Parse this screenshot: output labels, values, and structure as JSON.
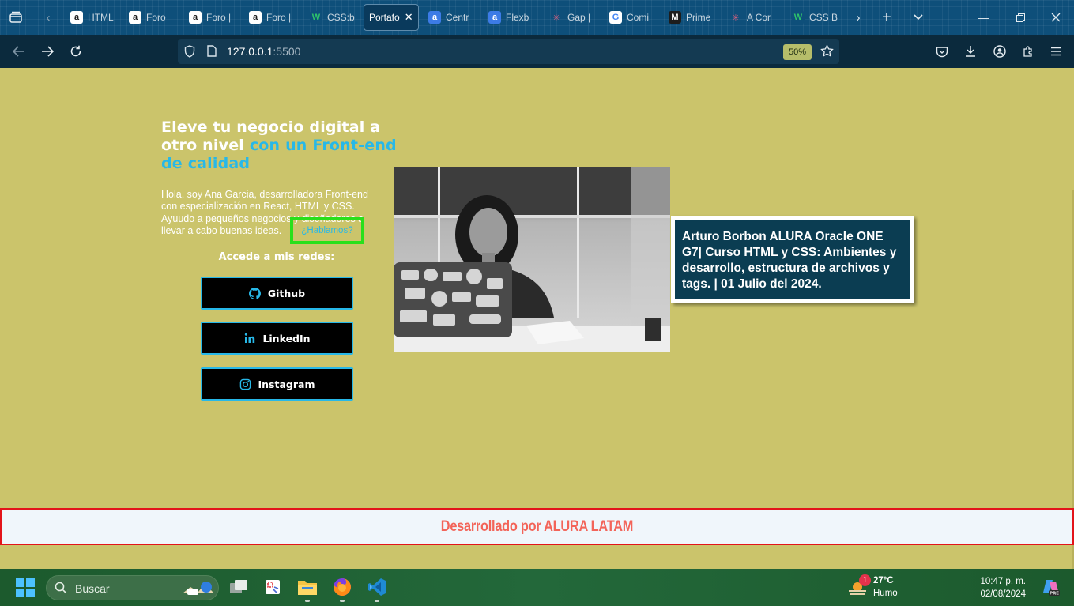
{
  "browser": {
    "tabs": [
      {
        "label": "HTML",
        "favicon": "a",
        "fav_bg": "#ffffff",
        "fav_fg": "#1e1e1e"
      },
      {
        "label": "Foro",
        "favicon": "a",
        "fav_bg": "#ffffff",
        "fav_fg": "#1e1e1e"
      },
      {
        "label": "Foro |",
        "favicon": "a",
        "fav_bg": "#ffffff",
        "fav_fg": "#1e1e1e"
      },
      {
        "label": "Foro |",
        "favicon": "a",
        "fav_bg": "#ffffff",
        "fav_fg": "#1e1e1e"
      },
      {
        "label": "CSS:b",
        "favicon": "W",
        "fav_bg": "#0e4f7a",
        "fav_fg": "#2ec36a"
      },
      {
        "label": "Portafo",
        "favicon": "",
        "fav_bg": "transparent",
        "fav_fg": "#ffffff",
        "active": true
      },
      {
        "label": "Centr",
        "favicon": "a",
        "fav_bg": "#3c7be6",
        "fav_fg": "#ffffff"
      },
      {
        "label": "Flexb",
        "favicon": "a",
        "fav_bg": "#3c7be6",
        "fav_fg": "#ffffff"
      },
      {
        "label": "Gap |",
        "favicon": "✳",
        "fav_bg": "transparent",
        "fav_fg": "#e0607e"
      },
      {
        "label": "Comi",
        "favicon": "G",
        "fav_bg": "#ffffff",
        "fav_fg": "#4285f4"
      },
      {
        "label": "Prime",
        "favicon": "M",
        "fav_bg": "#1d1d1d",
        "fav_fg": "#ffffff"
      },
      {
        "label": "A Cor",
        "favicon": "✳",
        "fav_bg": "transparent",
        "fav_fg": "#e0607e"
      },
      {
        "label": "CSS B",
        "favicon": "W",
        "fav_bg": "#0e4f7a",
        "fav_fg": "#2ec36a"
      }
    ],
    "url_host": "127.0.0.1",
    "url_port": ":5500",
    "zoom": "50%"
  },
  "page": {
    "title_part1": "Eleve tu negocio digital a otro nivel",
    "title_accent": "con un Front-end de calidad",
    "intro": "Hola, soy Ana Garcia, desarrolladora Front-end con especialización en React, HTML y CSS. Ayuudo a pequeños negocios y diseñadores a llevar a cabo buenas ideas.",
    "talk_link": "¿Hablamos?",
    "networks_title": "Accede a mis redes:",
    "social": [
      {
        "label": "Github",
        "icon": "github-icon"
      },
      {
        "label": "LinkedIn",
        "icon": "linkedin-icon"
      },
      {
        "label": "Instagram",
        "icon": "instagram-icon"
      }
    ],
    "caption": "Arturo Borbon ALURA Oracle ONE G7| Curso HTML y CSS: Ambientes y desarrollo, estructura de archivos y tags. | 01 Julio del 2024.",
    "footer": "Desarrollado por ALURA LATAM",
    "colors": {
      "background": "#cbc46b",
      "accent": "#27b8e8",
      "highlight_border": "#29e01b",
      "footer_text": "#f36459",
      "footer_border": "#e3141a",
      "caption_bg": "#0b3d52"
    }
  },
  "taskbar": {
    "search_placeholder": "Buscar",
    "weather_temp": "27°C",
    "weather_condition": "Humo",
    "notification_count": "1",
    "time": "10:47 p. m.",
    "date": "02/08/2024"
  }
}
